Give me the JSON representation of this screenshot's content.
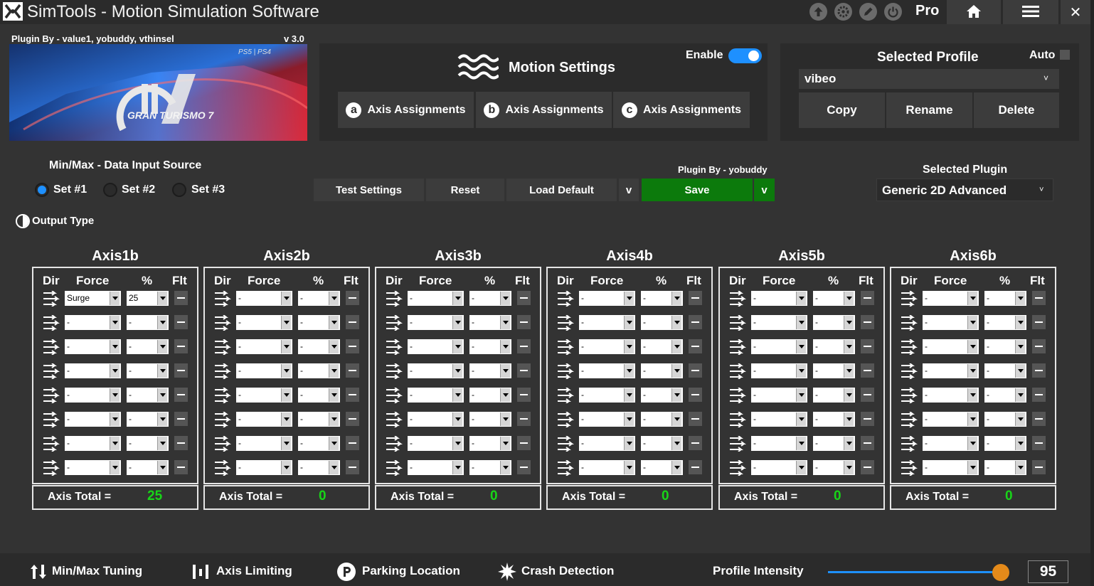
{
  "window": {
    "title": "SimTools - Motion Simulation Software",
    "edition": "Pro",
    "toolbar_icons": [
      "upload-icon",
      "gear-icon",
      "edit-icon",
      "power-icon"
    ],
    "home_icon": "home-icon",
    "menu_icon": "hamburger-menu-icon",
    "close_label": "✕"
  },
  "game": {
    "plugin_credit": "Plugin By - value1, yobuddy, vthinsel",
    "version": "v 3.0",
    "platform_badge": "PS5 | PS4",
    "cover_title": "GRAN TURISMO 7"
  },
  "motion": {
    "title": "Motion Settings",
    "enable_label": "Enable",
    "enabled": true,
    "tabs": [
      {
        "badge": "a",
        "label": "Axis Assignments"
      },
      {
        "badge": "b",
        "label": "Axis Assignments"
      },
      {
        "badge": "c",
        "label": "Axis Assignments"
      }
    ]
  },
  "profile": {
    "title": "Selected Profile",
    "auto_label": "Auto",
    "auto_checked": false,
    "selected": "vibeo",
    "dropdown_arrow": "˅",
    "buttons": [
      "Copy",
      "Rename",
      "Delete"
    ]
  },
  "input_source": {
    "title": "Min/Max - Data Input Source",
    "options": [
      "Set #1",
      "Set #2",
      "Set #3"
    ],
    "selected_index": 0
  },
  "output_type": {
    "label": "Output Type"
  },
  "actions": {
    "plugin_by": "Plugin By - yobuddy",
    "test_settings": "Test Settings",
    "reset": "Reset",
    "load_default": "Load Default",
    "save": "Save",
    "dropdown_label": "v"
  },
  "plugin": {
    "title": "Selected Plugin",
    "selected": "Generic 2D Advanced",
    "dropdown_arrow": "˅"
  },
  "axis_headers": {
    "dir": "Dir",
    "force": "Force",
    "pct": "%",
    "flt": "Flt"
  },
  "axis_total_label": "Axis Total =",
  "axes": [
    {
      "name": "Axis1b",
      "total": "25",
      "rows": [
        {
          "force": "Surge",
          "pct": "25"
        },
        {
          "force": "-",
          "pct": "-"
        },
        {
          "force": "-",
          "pct": "-"
        },
        {
          "force": "-",
          "pct": "-"
        },
        {
          "force": "-",
          "pct": "-"
        },
        {
          "force": "-",
          "pct": "-"
        },
        {
          "force": "-",
          "pct": "-"
        },
        {
          "force": "-",
          "pct": "-"
        }
      ]
    },
    {
      "name": "Axis2b",
      "total": "0",
      "rows": [
        {
          "force": "-",
          "pct": "-"
        },
        {
          "force": "-",
          "pct": "-"
        },
        {
          "force": "-",
          "pct": "-"
        },
        {
          "force": "-",
          "pct": "-"
        },
        {
          "force": "-",
          "pct": "-"
        },
        {
          "force": "-",
          "pct": "-"
        },
        {
          "force": "-",
          "pct": "-"
        },
        {
          "force": "-",
          "pct": "-"
        }
      ]
    },
    {
      "name": "Axis3b",
      "total": "0",
      "rows": [
        {
          "force": "-",
          "pct": "-"
        },
        {
          "force": "-",
          "pct": "-"
        },
        {
          "force": "-",
          "pct": "-"
        },
        {
          "force": "-",
          "pct": "-"
        },
        {
          "force": "-",
          "pct": "-"
        },
        {
          "force": "-",
          "pct": "-"
        },
        {
          "force": "-",
          "pct": "-"
        },
        {
          "force": "-",
          "pct": "-"
        }
      ]
    },
    {
      "name": "Axis4b",
      "total": "0",
      "rows": [
        {
          "force": "-",
          "pct": "-"
        },
        {
          "force": "-",
          "pct": "-"
        },
        {
          "force": "-",
          "pct": "-"
        },
        {
          "force": "-",
          "pct": "-"
        },
        {
          "force": "-",
          "pct": "-"
        },
        {
          "force": "-",
          "pct": "-"
        },
        {
          "force": "-",
          "pct": "-"
        },
        {
          "force": "-",
          "pct": "-"
        }
      ]
    },
    {
      "name": "Axis5b",
      "total": "0",
      "rows": [
        {
          "force": "-",
          "pct": "-"
        },
        {
          "force": "-",
          "pct": "-"
        },
        {
          "force": "-",
          "pct": "-"
        },
        {
          "force": "-",
          "pct": "-"
        },
        {
          "force": "-",
          "pct": "-"
        },
        {
          "force": "-",
          "pct": "-"
        },
        {
          "force": "-",
          "pct": "-"
        },
        {
          "force": "-",
          "pct": "-"
        }
      ]
    },
    {
      "name": "Axis6b",
      "total": "0",
      "rows": [
        {
          "force": "-",
          "pct": "-"
        },
        {
          "force": "-",
          "pct": "-"
        },
        {
          "force": "-",
          "pct": "-"
        },
        {
          "force": "-",
          "pct": "-"
        },
        {
          "force": "-",
          "pct": "-"
        },
        {
          "force": "-",
          "pct": "-"
        },
        {
          "force": "-",
          "pct": "-"
        },
        {
          "force": "-",
          "pct": "-"
        }
      ]
    }
  ],
  "bottom_nav": [
    {
      "icon": "tuning-arrows-icon",
      "label": "Min/Max Tuning"
    },
    {
      "icon": "axis-limit-bars-icon",
      "label": "Axis Limiting"
    },
    {
      "icon": "parking-p-icon",
      "label": "Parking Location"
    },
    {
      "icon": "crash-burst-icon",
      "label": "Crash Detection"
    }
  ],
  "intensity": {
    "label": "Profile Intensity",
    "value": "95",
    "level_percent": 95
  },
  "colors": {
    "background": "#333333",
    "panel": "#2b2b2b",
    "button": "#3c3c3c",
    "accent_blue": "#1e90ff",
    "save_green": "#0c7a0c",
    "total_green": "#18d418",
    "slider_thumb": "#e48a1a"
  }
}
